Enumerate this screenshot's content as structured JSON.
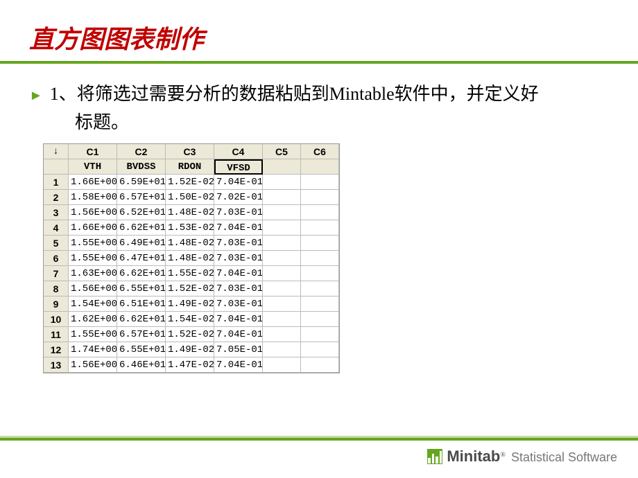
{
  "title": "直方图图表制作",
  "bullet_text": "1、将筛选过需要分析的数据粘贴到Mintable软件中，并定义好",
  "bullet_sub": "标题。",
  "worksheet": {
    "corner": "↓",
    "col_headers": [
      "C1",
      "C2",
      "C3",
      "C4",
      "C5",
      "C6"
    ],
    "col_names": [
      "VTH",
      "BVDSS",
      "RDON",
      "VFSD",
      "",
      ""
    ],
    "selected_col_index": 3,
    "rows": [
      {
        "n": "1",
        "c": [
          "1.66E+00",
          "6.59E+01",
          "1.52E-02",
          "7.04E-01",
          "",
          ""
        ]
      },
      {
        "n": "2",
        "c": [
          "1.58E+00",
          "6.57E+01",
          "1.50E-02",
          "7.02E-01",
          "",
          ""
        ]
      },
      {
        "n": "3",
        "c": [
          "1.56E+00",
          "6.52E+01",
          "1.48E-02",
          "7.03E-01",
          "",
          ""
        ]
      },
      {
        "n": "4",
        "c": [
          "1.66E+00",
          "6.62E+01",
          "1.53E-02",
          "7.04E-01",
          "",
          ""
        ]
      },
      {
        "n": "5",
        "c": [
          "1.55E+00",
          "6.49E+01",
          "1.48E-02",
          "7.03E-01",
          "",
          ""
        ]
      },
      {
        "n": "6",
        "c": [
          "1.55E+00",
          "6.47E+01",
          "1.48E-02",
          "7.03E-01",
          "",
          ""
        ]
      },
      {
        "n": "7",
        "c": [
          "1.63E+00",
          "6.62E+01",
          "1.55E-02",
          "7.04E-01",
          "",
          ""
        ]
      },
      {
        "n": "8",
        "c": [
          "1.56E+00",
          "6.55E+01",
          "1.52E-02",
          "7.03E-01",
          "",
          ""
        ]
      },
      {
        "n": "9",
        "c": [
          "1.54E+00",
          "6.51E+01",
          "1.49E-02",
          "7.03E-01",
          "",
          ""
        ]
      },
      {
        "n": "10",
        "c": [
          "1.62E+00",
          "6.62E+01",
          "1.54E-02",
          "7.04E-01",
          "",
          ""
        ]
      },
      {
        "n": "11",
        "c": [
          "1.55E+00",
          "6.57E+01",
          "1.52E-02",
          "7.04E-01",
          "",
          ""
        ]
      },
      {
        "n": "12",
        "c": [
          "1.74E+00",
          "6.55E+01",
          "1.49E-02",
          "7.05E-01",
          "",
          ""
        ]
      },
      {
        "n": "13",
        "c": [
          "1.56E+00",
          "6.46E+01",
          "1.47E-02",
          "7.04E-01",
          "",
          ""
        ]
      }
    ]
  },
  "brand": {
    "name": "Minitab",
    "reg": "®",
    "tag": "Statistical Software"
  }
}
